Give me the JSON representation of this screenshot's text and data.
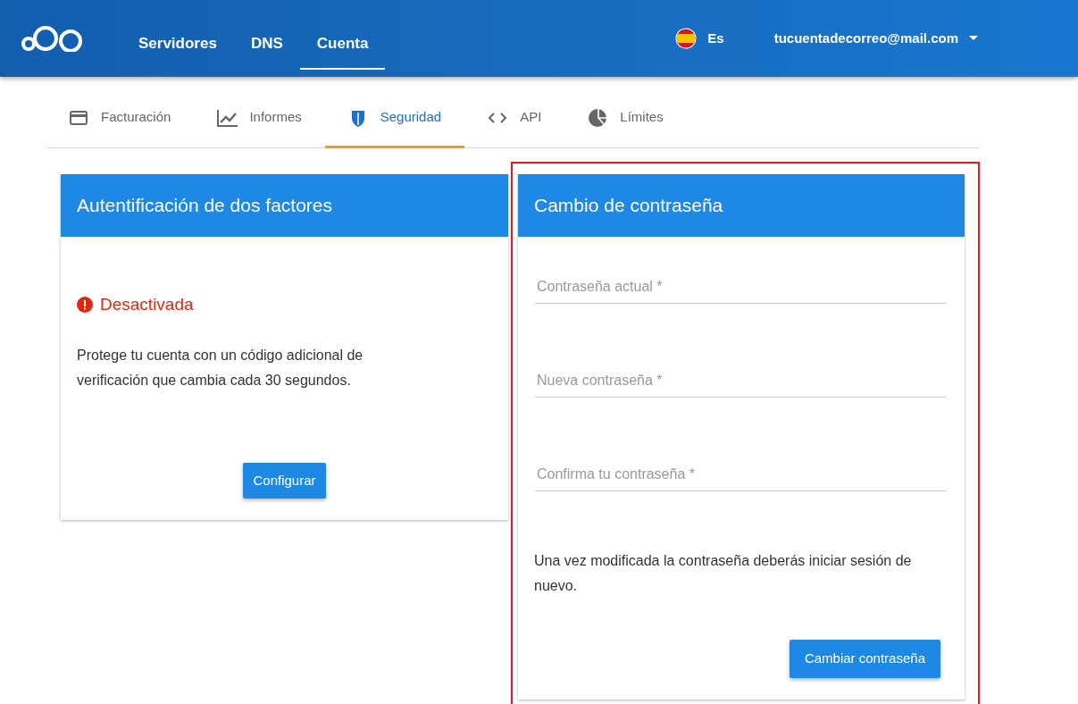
{
  "header": {
    "nav": [
      {
        "label": "Servidores",
        "selected": false
      },
      {
        "label": "DNS",
        "selected": false
      },
      {
        "label": "Cuenta",
        "selected": true
      }
    ],
    "language": "Es",
    "account": "tucuentadecorreo@mail.com"
  },
  "tabs": [
    {
      "label": "Facturación",
      "kind": "card",
      "selected": false
    },
    {
      "label": "Informes",
      "kind": "chart",
      "selected": false
    },
    {
      "label": "Seguridad",
      "kind": "shield",
      "selected": true
    },
    {
      "label": "API",
      "kind": "code",
      "selected": false
    },
    {
      "label": "Límites",
      "kind": "pie",
      "selected": false
    }
  ],
  "two_factor": {
    "title": "Autentificación de dos factores",
    "status": "Desactivada",
    "enabled": false,
    "description": "Protege tu cuenta con un código adicional de verificación que cambia cada 30 segundos.",
    "button": "Configurar"
  },
  "password_change": {
    "title": "Cambio de contraseña",
    "highlighted": true,
    "fields": [
      {
        "placeholder": "Contraseña actual *"
      },
      {
        "placeholder": "Nueva contraseña *"
      },
      {
        "placeholder": "Confirma tu contraseña *"
      }
    ],
    "note": "Una vez modificada la contraseña deberás iniciar sesión de nuevo.",
    "button": "Cambiar contraseña"
  }
}
